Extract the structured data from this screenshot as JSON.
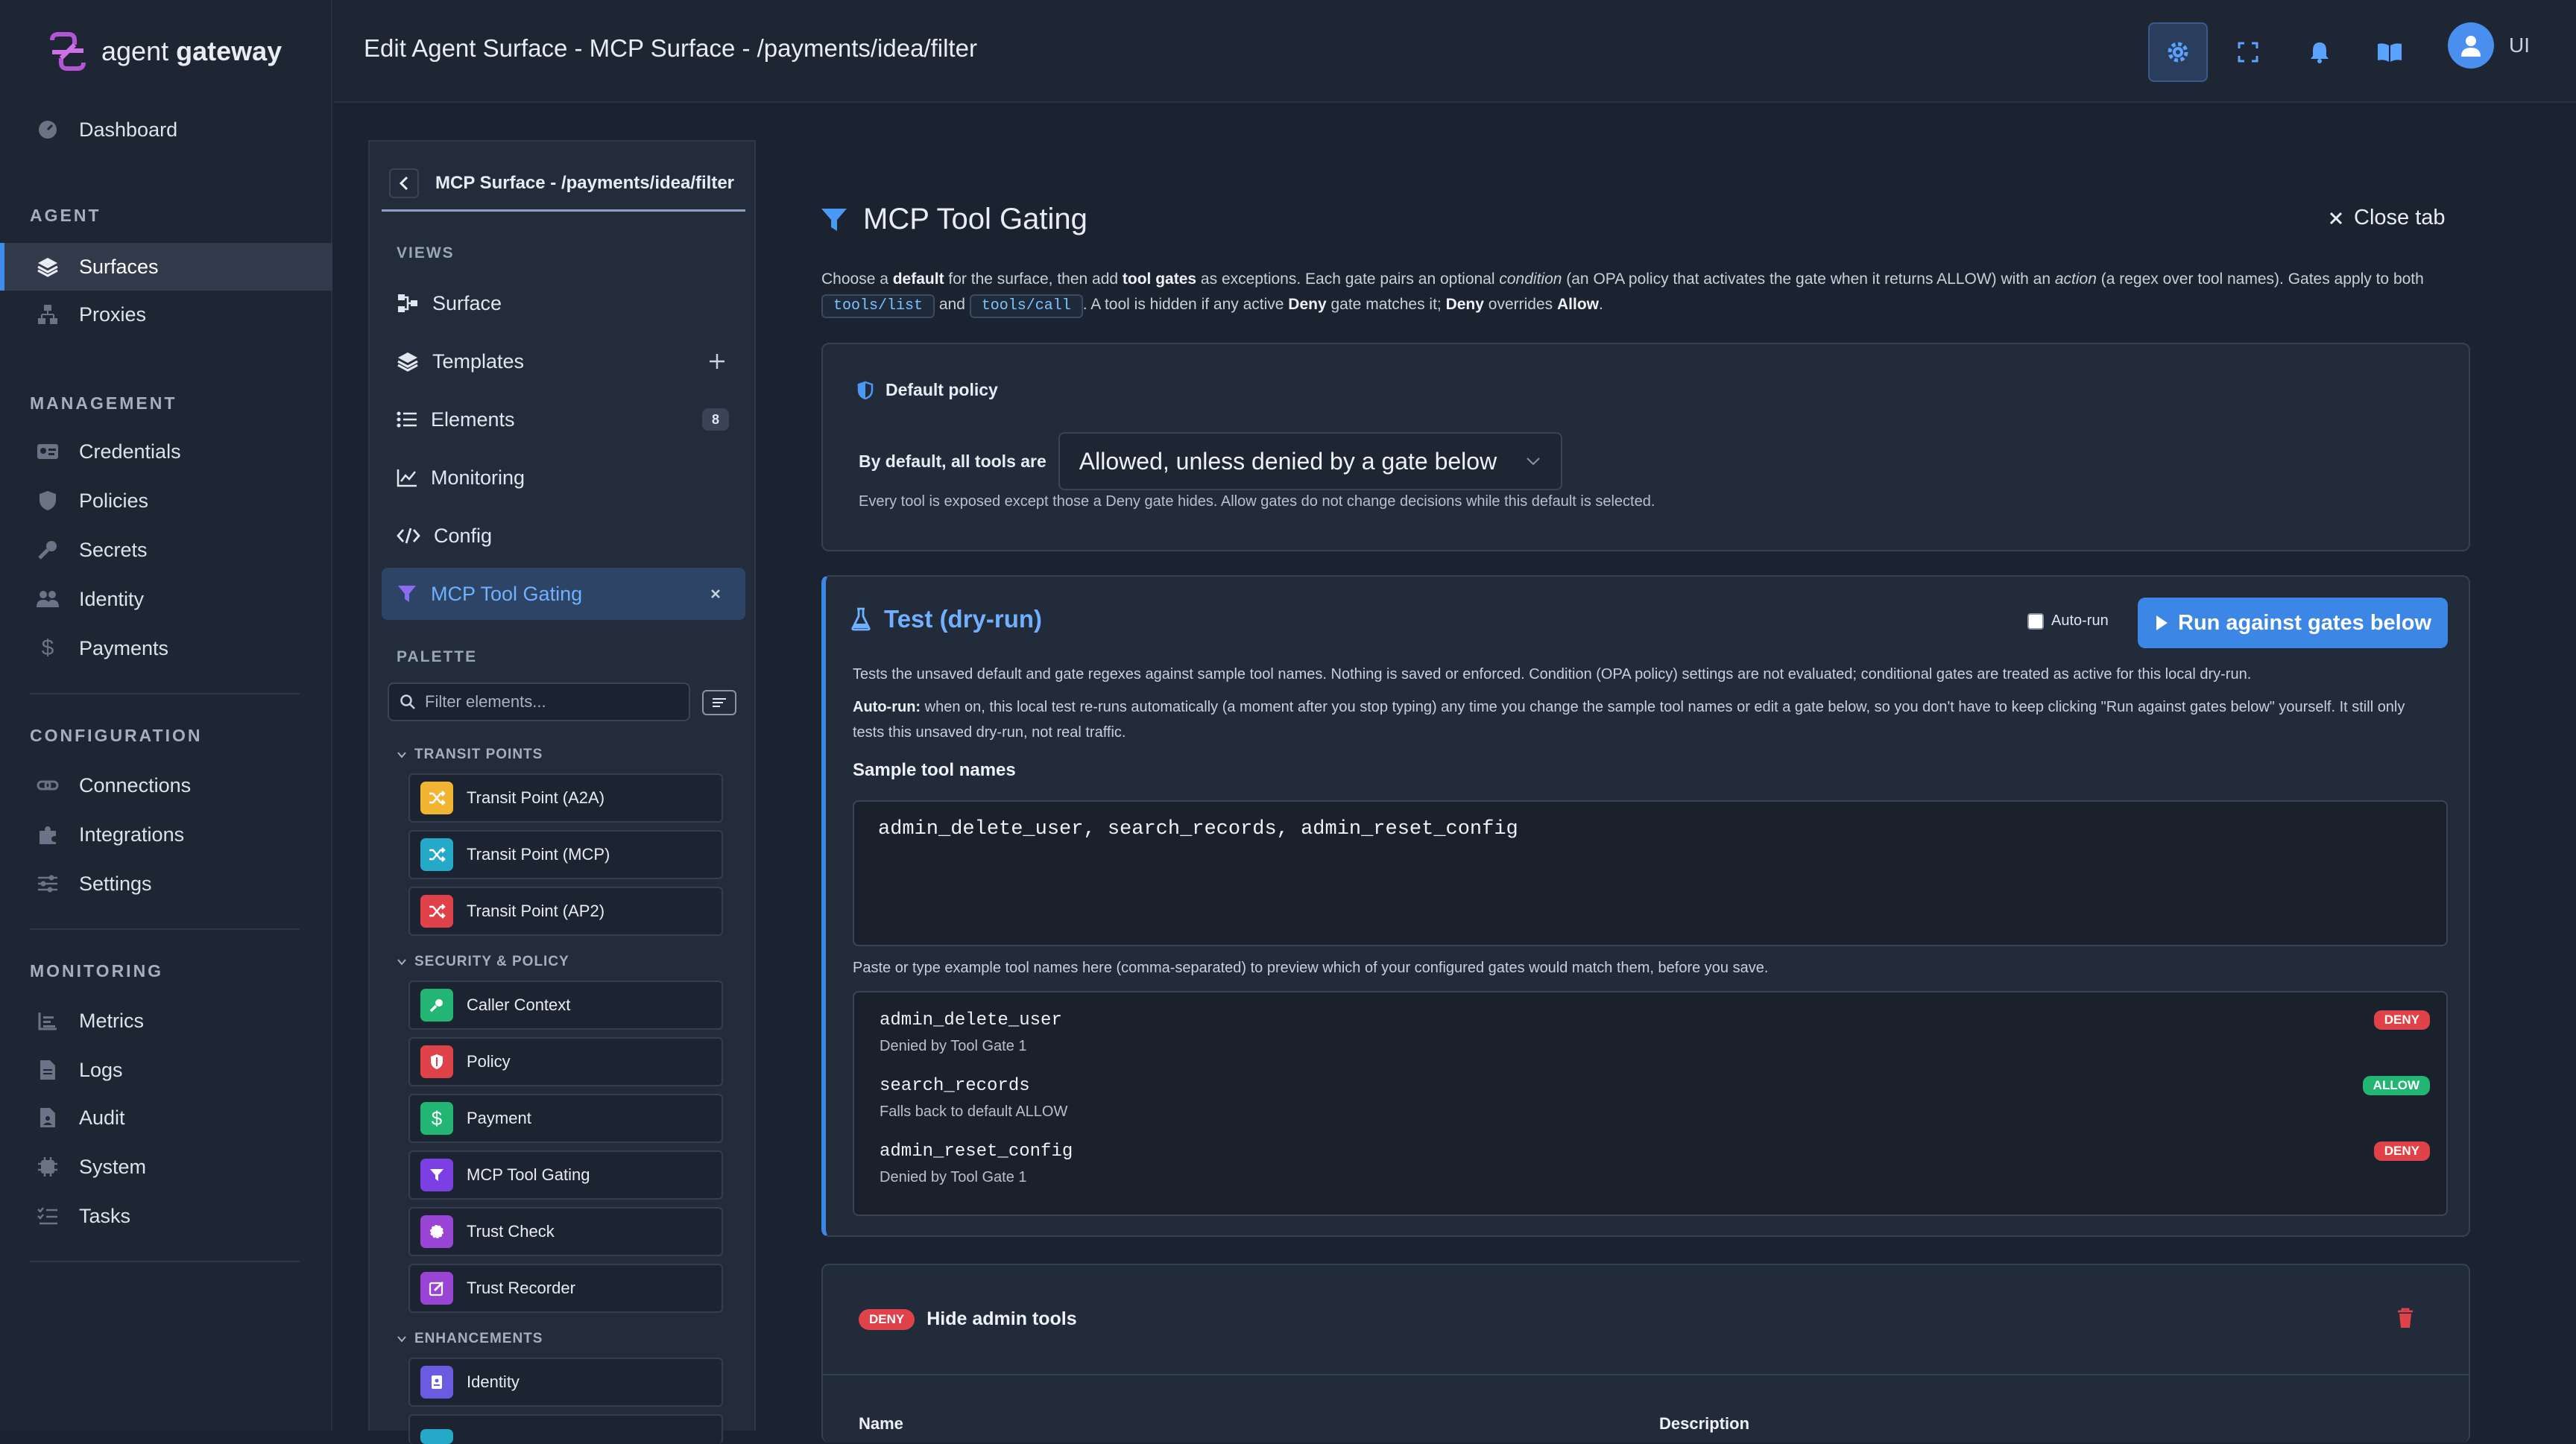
{
  "app": {
    "brand_light": "agent ",
    "brand_bold": "gateway"
  },
  "nav": {
    "dashboard": "Dashboard",
    "sec_agent": "AGENT",
    "surfaces": "Surfaces",
    "proxies": "Proxies",
    "sec_management": "MANAGEMENT",
    "credentials": "Credentials",
    "policies": "Policies",
    "secrets": "Secrets",
    "identity": "Identity",
    "payments": "Payments",
    "sec_configuration": "CONFIGURATION",
    "connections": "Connections",
    "integrations": "Integrations",
    "settings": "Settings",
    "sec_monitoring": "MONITORING",
    "metrics": "Metrics",
    "logs": "Logs",
    "audit": "Audit",
    "system": "System",
    "tasks": "Tasks"
  },
  "header": {
    "title": "Edit Agent Surface - MCP Surface - /payments/idea/filter",
    "user_initials": "UI"
  },
  "panel": {
    "title": "MCP Surface - /payments/idea/filter",
    "views_label": "VIEWS",
    "views": {
      "surface": "Surface",
      "templates": "Templates",
      "elements": "Elements",
      "elements_count": "8",
      "monitoring": "Monitoring",
      "config": "Config",
      "gating": "MCP Tool Gating"
    },
    "palette_label": "PALETTE",
    "filter_placeholder": "Filter elements...",
    "groups": {
      "transit": "TRANSIT POINTS",
      "security": "SECURITY & POLICY",
      "enhancements": "ENHANCEMENTS"
    },
    "items": {
      "a2a": "Transit Point (A2A)",
      "mcp": "Transit Point (MCP)",
      "ap2": "Transit Point (AP2)",
      "caller": "Caller Context",
      "policy": "Policy",
      "payment": "Payment",
      "gating": "MCP Tool Gating",
      "trust_check": "Trust Check",
      "trust_recorder": "Trust Recorder",
      "identity": "Identity"
    }
  },
  "main": {
    "title": "MCP Tool Gating",
    "close": "Close tab",
    "desc": {
      "p1": "Choose a ",
      "b1": "default",
      "p2": " for the surface, then add ",
      "b2": "tool gates",
      "p3": " as exceptions. Each gate pairs an optional ",
      "i1": "condition",
      "p4": " (an OPA policy that activates the gate when it returns ALLOW) with an ",
      "i2": "action",
      "p5": " (a regex over tool names). Gates apply to both",
      "code1": "tools/list",
      "p6": " and ",
      "code2": "tools/call",
      "p7": ". A tool is hidden if any active ",
      "b3": "Deny",
      "p8": " gate matches it; ",
      "b4": "Deny",
      "p9": " overrides ",
      "b5": "Allow",
      "p10": "."
    },
    "default_policy": {
      "heading": "Default policy",
      "label": "By default, all tools are",
      "value": "Allowed, unless denied by a gate below",
      "note": "Every tool is exposed except those a Deny gate hides. Allow gates do not change decisions while this default is selected."
    },
    "test": {
      "title": "Test (dry-run)",
      "autorun": "Auto-run",
      "run_button": "Run against gates below",
      "desc": "Tests the unsaved default and gate regexes against sample tool names. Nothing is saved or enforced. Condition (OPA policy) settings are not evaluated; conditional gates are treated as active for this local dry-run.",
      "auto_bold": "Auto-run:",
      "auto_text": " when on, this local test re-runs automatically (a moment after you stop typing) any time you change the sample tool names or edit a gate below, so you don't have to keep clicking \"Run against gates below\" yourself. It still only tests this unsaved dry-run, not real traffic.",
      "sample_label": "Sample tool names",
      "sample_value": "admin_delete_user, search_records, admin_reset_config",
      "hint": "Paste or type example tool names here (comma-separated) to preview which of your configured gates would match them, before you save.",
      "results": [
        {
          "name": "admin_delete_user",
          "reason": "Denied by Tool Gate 1",
          "verdict": "DENY"
        },
        {
          "name": "search_records",
          "reason": "Falls back to default ALLOW",
          "verdict": "ALLOW"
        },
        {
          "name": "admin_reset_config",
          "reason": "Denied by Tool Gate 1",
          "verdict": "DENY"
        }
      ]
    },
    "gate": {
      "verdict": "DENY",
      "name": "Hide admin tools",
      "col_name": "Name",
      "col_desc": "Description"
    }
  },
  "colors": {
    "accent": "#3c86e6",
    "deny": "#e0424a",
    "allow": "#22b573"
  }
}
